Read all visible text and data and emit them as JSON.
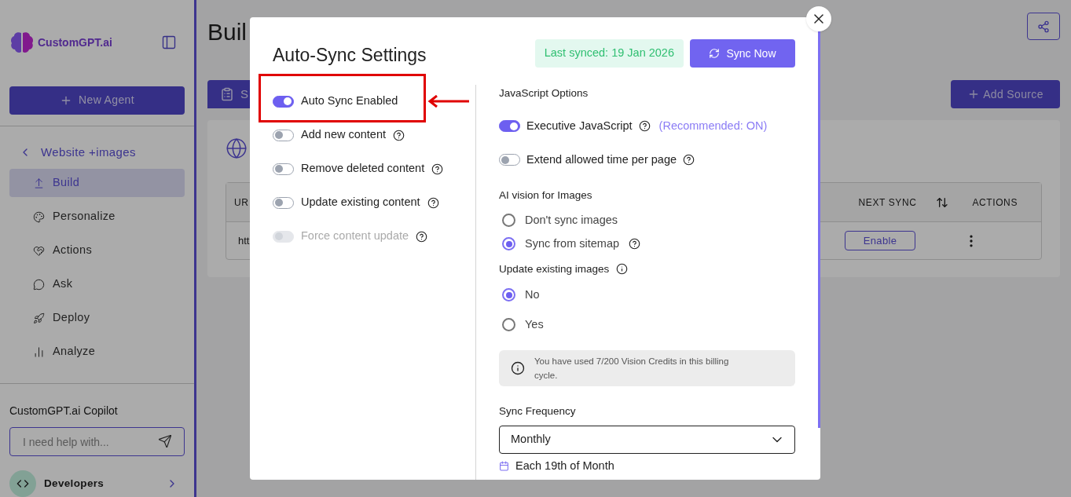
{
  "sidebar": {
    "logo": "CustomGPT.ai",
    "new_agent": "New Agent",
    "back": "Website +images",
    "items": [
      {
        "label": "Build",
        "selected": true
      },
      {
        "label": "Personalize",
        "selected": false
      },
      {
        "label": "Actions",
        "selected": false
      },
      {
        "label": "Ask",
        "selected": false
      },
      {
        "label": "Deploy",
        "selected": false
      },
      {
        "label": "Analyze",
        "selected": false
      }
    ],
    "copilot": {
      "title": "CustomGPT.ai Copilot",
      "placeholder": "I need help with..."
    },
    "developers": "Developers"
  },
  "main": {
    "title": "Buil",
    "tab": "S",
    "add_source": "Add Source",
    "table": {
      "columns": [
        "UR",
        "NEXT SYNC",
        "ACTIONS"
      ],
      "rows": [
        {
          "url": "htt",
          "next_sync": "Enable"
        }
      ]
    }
  },
  "modal": {
    "title": "Auto-Sync Settings",
    "last_synced": "Last synced: 19 Jan 2026",
    "sync_now": "Sync Now",
    "toggles": [
      {
        "label": "Auto Sync Enabled",
        "on": true,
        "disabled": false,
        "help": false,
        "highlighted": true
      },
      {
        "label": "Add new content",
        "on": false,
        "disabled": false,
        "help": true,
        "highlighted": false
      },
      {
        "label": "Remove deleted content",
        "on": false,
        "disabled": false,
        "help": true,
        "highlighted": false
      },
      {
        "label": "Update existing content",
        "on": false,
        "disabled": false,
        "help": true,
        "highlighted": false
      },
      {
        "label": "Force content update",
        "on": false,
        "disabled": true,
        "help": true,
        "highlighted": false
      }
    ],
    "js_options": {
      "title": "JavaScript Options",
      "toggles": [
        {
          "label": "Executive JavaScript",
          "on": true,
          "help": true,
          "note": "(Recommended: ON)"
        },
        {
          "label": "Extend allowed time per page",
          "on": false,
          "help": true
        }
      ]
    },
    "ai_vision": {
      "title": "AI vision for Images",
      "options": [
        {
          "label": "Don't sync images",
          "selected": false,
          "help": false
        },
        {
          "label": "Sync from sitemap",
          "selected": true,
          "help": true
        }
      ]
    },
    "update_images": {
      "title": "Update existing images",
      "options": [
        {
          "label": "No",
          "selected": true
        },
        {
          "label": "Yes",
          "selected": false
        }
      ]
    },
    "info": "You have used 7/200 Vision Credits in this billing cycle.",
    "sync_frequency": {
      "label": "Sync Frequency",
      "value": "Monthly",
      "schedule": "Each 19th of Month"
    }
  }
}
